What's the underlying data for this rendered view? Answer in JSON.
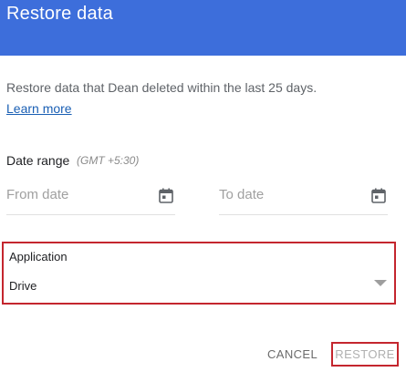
{
  "dialog": {
    "title": "Restore data",
    "description": "Restore data that Dean deleted within the last 25 days.",
    "learn_more": "Learn more"
  },
  "date_range": {
    "label": "Date range",
    "timezone": "(GMT +5:30)",
    "from_placeholder": "From date",
    "to_placeholder": "To date",
    "icon": "calendar-icon"
  },
  "application": {
    "label": "Application",
    "selected": "Drive",
    "icon": "chevron-down-icon"
  },
  "actions": {
    "cancel": "CANCEL",
    "restore": "RESTORE"
  },
  "colors": {
    "header": "#3d6edb",
    "highlight_border": "#c4262e",
    "link": "#1a5fb4"
  }
}
